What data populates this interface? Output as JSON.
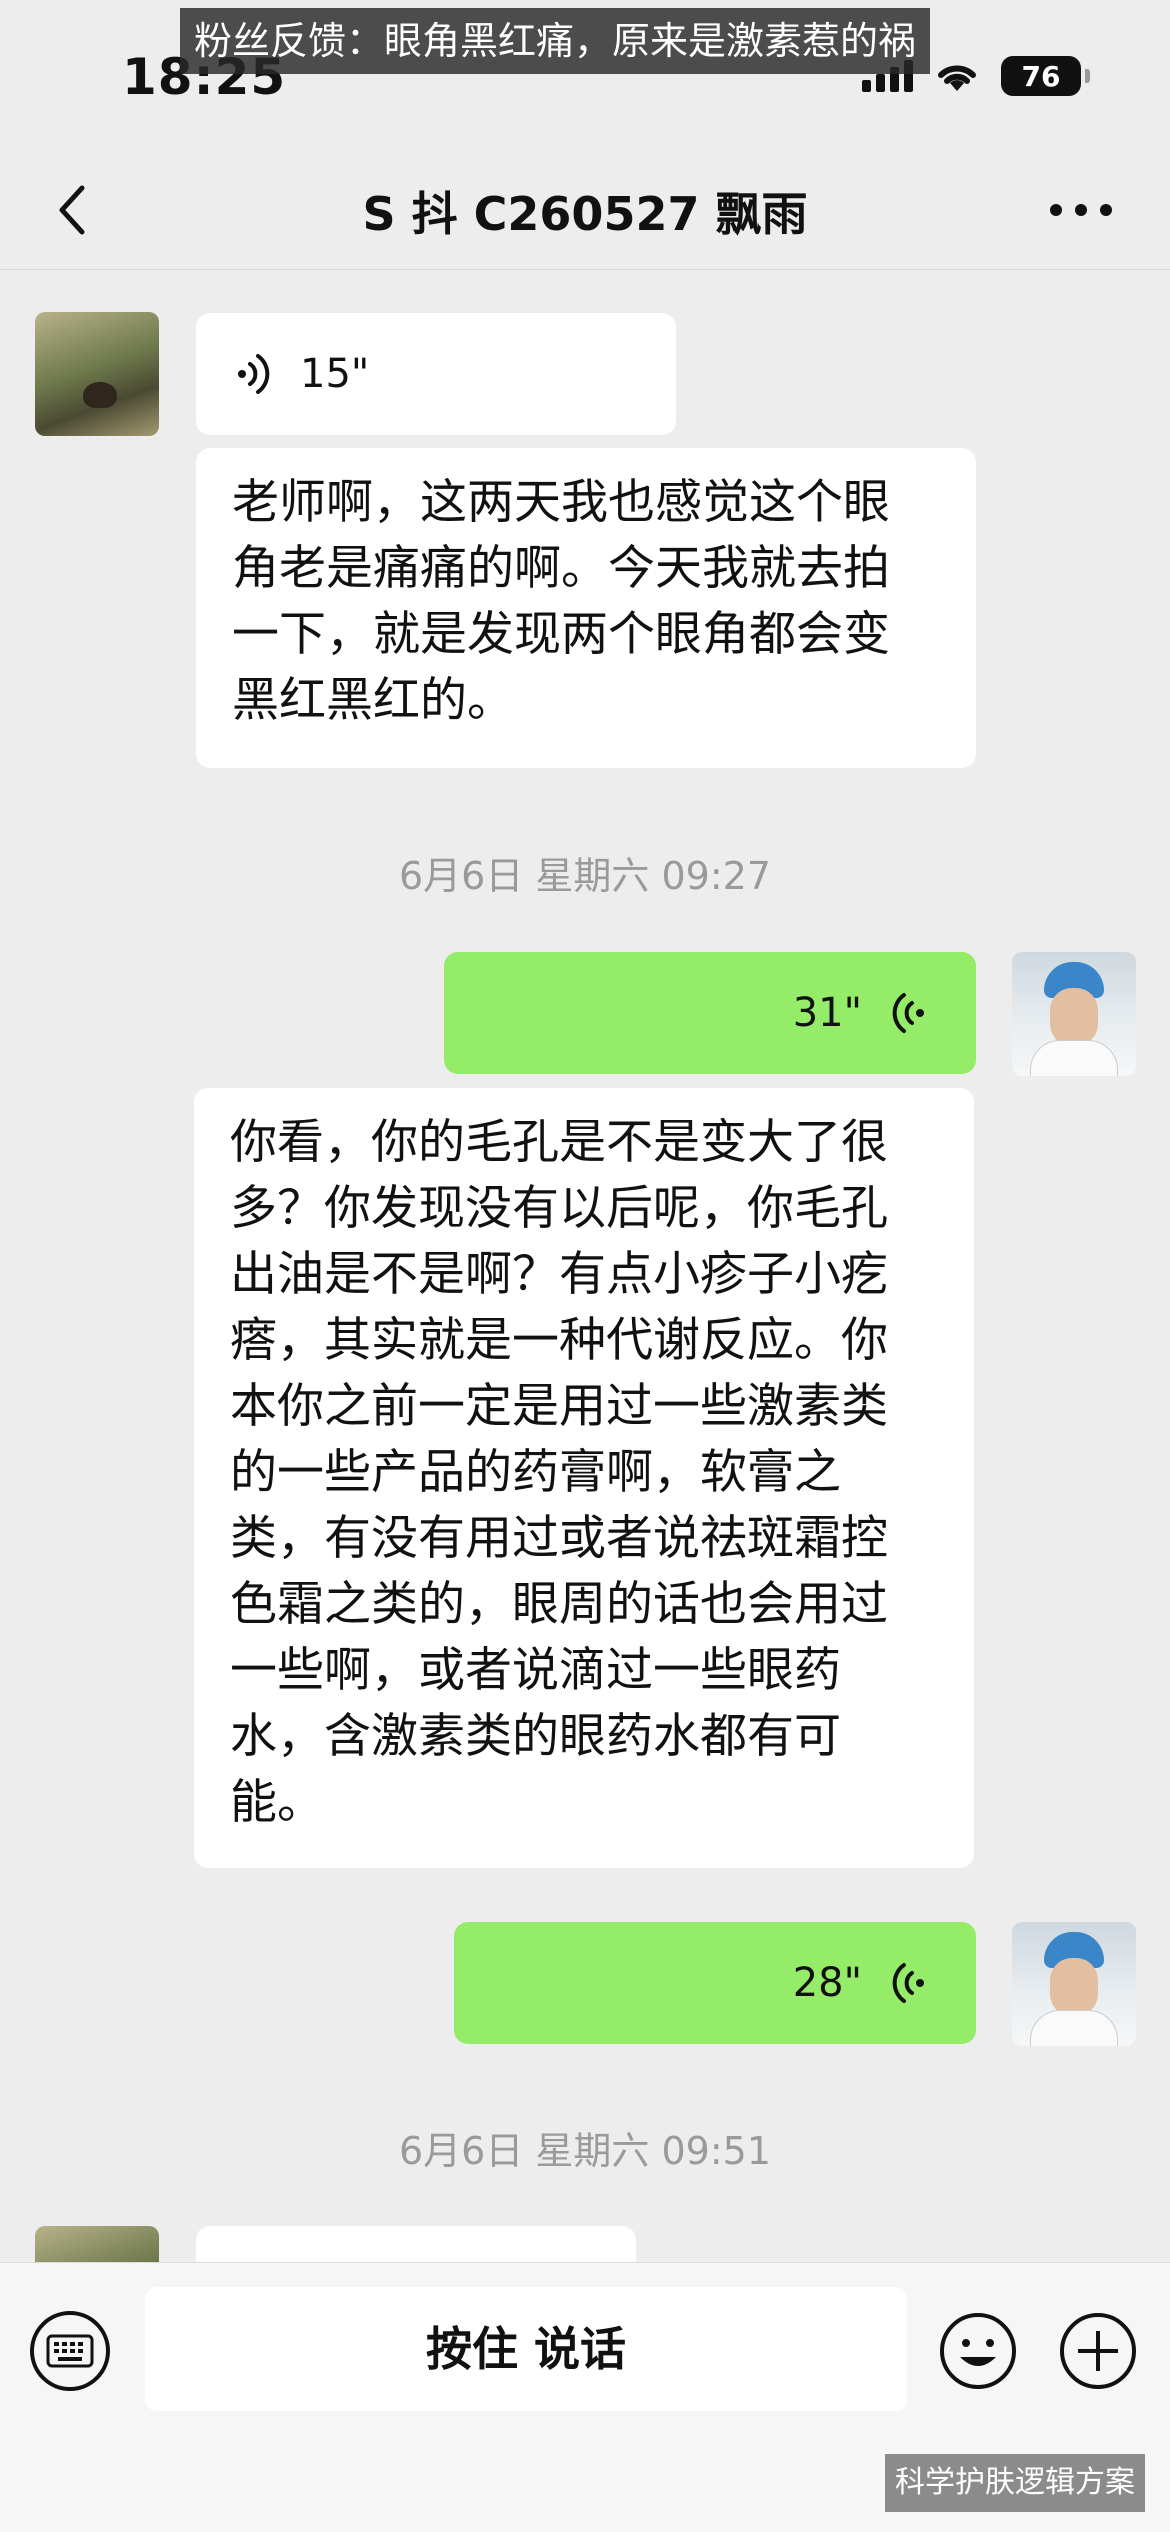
{
  "status_bar": {
    "time": "18:25",
    "battery": "76"
  },
  "overlay_caption": "粉丝反馈：眼角黑红痛，原来是激素惹的祸",
  "header": {
    "title": "S 抖 C260527 飘雨"
  },
  "messages": {
    "m1_voice": {
      "duration": "15\""
    },
    "m2_text": {
      "text": "老师啊，这两天我也感觉这个眼\n角老是痛痛的啊。今天我就去拍\n一下，就是发现两个眼角都会变\n黑红黑红的。"
    },
    "ts1": "6月6日 星期六 09:27",
    "m3_voice": {
      "duration": "31\""
    },
    "m4_text": {
      "text": "你看，你的毛孔是不是变大了很\n多？你发现没有以后呢，你毛孔\n出油是不是啊？有点小疹子小疙\n瘩，其实就是一种代谢反应。你\n本你之前一定是用过一些激素类\n的一些产品的药膏啊，软膏之\n类，有没有用过或者说祛斑霜控\n色霜之类的，眼周的话也会用过\n一些啊，或者说滴过一些眼药\n水，含激素类的眼药水都有可\n能。"
    },
    "m5_voice": {
      "duration": "28\""
    },
    "ts2": "6月6日 星期六 09:51"
  },
  "input_bar": {
    "hold_to_talk": "按住 说话"
  },
  "watermark": "科学护肤逻辑方案",
  "colors": {
    "background": "#ededed",
    "bubble_white": "#ffffff",
    "bubble_green": "#95ec69",
    "timestamp": "#9a9a9a"
  },
  "icons": [
    "back-icon",
    "more-icon",
    "signal-icon",
    "wifi-icon",
    "battery-icon",
    "voice-wave-icon",
    "keyboard-icon",
    "emoji-icon",
    "plus-icon"
  ]
}
